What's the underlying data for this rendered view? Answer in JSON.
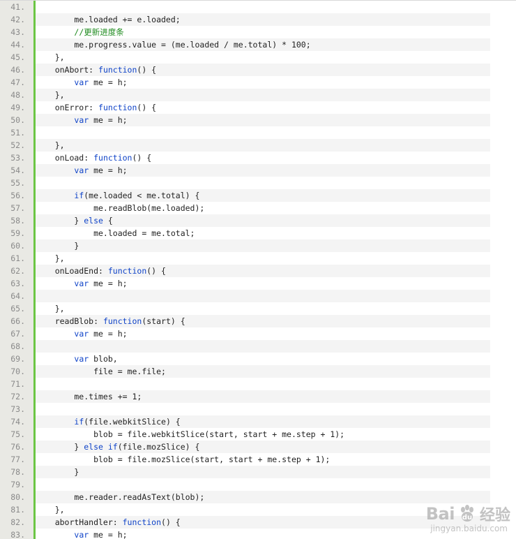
{
  "code_view": {
    "lines": [
      {
        "num": "41.",
        "tokens": [
          {
            "t": "",
            "c": "pl"
          }
        ]
      },
      {
        "num": "42.",
        "tokens": [
          {
            "t": "        me.loaded += e.loaded;",
            "c": "pl"
          }
        ]
      },
      {
        "num": "43.",
        "tokens": [
          {
            "t": "        ",
            "c": "pl"
          },
          {
            "t": "//更新进度条",
            "c": "cm"
          }
        ]
      },
      {
        "num": "44.",
        "tokens": [
          {
            "t": "        me.progress.value = (me.loaded / me.total) * 100;",
            "c": "pl"
          }
        ]
      },
      {
        "num": "45.",
        "tokens": [
          {
            "t": "    },",
            "c": "pl"
          }
        ]
      },
      {
        "num": "46.",
        "tokens": [
          {
            "t": "    onAbort: ",
            "c": "pl"
          },
          {
            "t": "function",
            "c": "kw"
          },
          {
            "t": "() {",
            "c": "pl"
          }
        ]
      },
      {
        "num": "47.",
        "tokens": [
          {
            "t": "        ",
            "c": "pl"
          },
          {
            "t": "var",
            "c": "kw"
          },
          {
            "t": " me = h;",
            "c": "pl"
          }
        ]
      },
      {
        "num": "48.",
        "tokens": [
          {
            "t": "    },",
            "c": "pl"
          }
        ]
      },
      {
        "num": "49.",
        "tokens": [
          {
            "t": "    onError: ",
            "c": "pl"
          },
          {
            "t": "function",
            "c": "kw"
          },
          {
            "t": "() {",
            "c": "pl"
          }
        ]
      },
      {
        "num": "50.",
        "tokens": [
          {
            "t": "        ",
            "c": "pl"
          },
          {
            "t": "var",
            "c": "kw"
          },
          {
            "t": " me = h;",
            "c": "pl"
          }
        ]
      },
      {
        "num": "51.",
        "tokens": [
          {
            "t": "",
            "c": "pl"
          }
        ]
      },
      {
        "num": "52.",
        "tokens": [
          {
            "t": "    },",
            "c": "pl"
          }
        ]
      },
      {
        "num": "53.",
        "tokens": [
          {
            "t": "    onLoad: ",
            "c": "pl"
          },
          {
            "t": "function",
            "c": "kw"
          },
          {
            "t": "() {",
            "c": "pl"
          }
        ]
      },
      {
        "num": "54.",
        "tokens": [
          {
            "t": "        ",
            "c": "pl"
          },
          {
            "t": "var",
            "c": "kw"
          },
          {
            "t": " me = h;",
            "c": "pl"
          }
        ]
      },
      {
        "num": "55.",
        "tokens": [
          {
            "t": "",
            "c": "pl"
          }
        ]
      },
      {
        "num": "56.",
        "tokens": [
          {
            "t": "        ",
            "c": "pl"
          },
          {
            "t": "if",
            "c": "kw"
          },
          {
            "t": "(me.loaded < me.total) {",
            "c": "pl"
          }
        ]
      },
      {
        "num": "57.",
        "tokens": [
          {
            "t": "            me.readBlob(me.loaded);",
            "c": "pl"
          }
        ]
      },
      {
        "num": "58.",
        "tokens": [
          {
            "t": "        } ",
            "c": "pl"
          },
          {
            "t": "else",
            "c": "kw"
          },
          {
            "t": " {",
            "c": "pl"
          }
        ]
      },
      {
        "num": "59.",
        "tokens": [
          {
            "t": "            me.loaded = me.total;",
            "c": "pl"
          }
        ]
      },
      {
        "num": "60.",
        "tokens": [
          {
            "t": "        }",
            "c": "pl"
          }
        ]
      },
      {
        "num": "61.",
        "tokens": [
          {
            "t": "    },",
            "c": "pl"
          }
        ]
      },
      {
        "num": "62.",
        "tokens": [
          {
            "t": "    onLoadEnd: ",
            "c": "pl"
          },
          {
            "t": "function",
            "c": "kw"
          },
          {
            "t": "() {",
            "c": "pl"
          }
        ]
      },
      {
        "num": "63.",
        "tokens": [
          {
            "t": "        ",
            "c": "pl"
          },
          {
            "t": "var",
            "c": "kw"
          },
          {
            "t": " me = h;",
            "c": "pl"
          }
        ]
      },
      {
        "num": "64.",
        "tokens": [
          {
            "t": "",
            "c": "pl"
          }
        ]
      },
      {
        "num": "65.",
        "tokens": [
          {
            "t": "    },",
            "c": "pl"
          }
        ]
      },
      {
        "num": "66.",
        "tokens": [
          {
            "t": "    readBlob: ",
            "c": "pl"
          },
          {
            "t": "function",
            "c": "kw"
          },
          {
            "t": "(start) {",
            "c": "pl"
          }
        ]
      },
      {
        "num": "67.",
        "tokens": [
          {
            "t": "        ",
            "c": "pl"
          },
          {
            "t": "var",
            "c": "kw"
          },
          {
            "t": " me = h;",
            "c": "pl"
          }
        ]
      },
      {
        "num": "68.",
        "tokens": [
          {
            "t": "",
            "c": "pl"
          }
        ]
      },
      {
        "num": "69.",
        "tokens": [
          {
            "t": "        ",
            "c": "pl"
          },
          {
            "t": "var",
            "c": "kw"
          },
          {
            "t": " blob,",
            "c": "pl"
          }
        ]
      },
      {
        "num": "70.",
        "tokens": [
          {
            "t": "            file = me.file;",
            "c": "pl"
          }
        ]
      },
      {
        "num": "71.",
        "tokens": [
          {
            "t": "",
            "c": "pl"
          }
        ]
      },
      {
        "num": "72.",
        "tokens": [
          {
            "t": "        me.times += 1;",
            "c": "pl"
          }
        ]
      },
      {
        "num": "73.",
        "tokens": [
          {
            "t": "",
            "c": "pl"
          }
        ]
      },
      {
        "num": "74.",
        "tokens": [
          {
            "t": "        ",
            "c": "pl"
          },
          {
            "t": "if",
            "c": "kw"
          },
          {
            "t": "(file.webkitSlice) {",
            "c": "pl"
          }
        ]
      },
      {
        "num": "75.",
        "tokens": [
          {
            "t": "            blob = file.webkitSlice(start, start + me.step + 1);",
            "c": "pl"
          }
        ]
      },
      {
        "num": "76.",
        "tokens": [
          {
            "t": "        } ",
            "c": "pl"
          },
          {
            "t": "else if",
            "c": "kw"
          },
          {
            "t": "(file.mozSlice) {",
            "c": "pl"
          }
        ]
      },
      {
        "num": "77.",
        "tokens": [
          {
            "t": "            blob = file.mozSlice(start, start + me.step + 1);",
            "c": "pl"
          }
        ]
      },
      {
        "num": "78.",
        "tokens": [
          {
            "t": "        }",
            "c": "pl"
          }
        ]
      },
      {
        "num": "79.",
        "tokens": [
          {
            "t": "",
            "c": "pl"
          }
        ]
      },
      {
        "num": "80.",
        "tokens": [
          {
            "t": "        me.reader.readAsText(blob);",
            "c": "pl"
          }
        ]
      },
      {
        "num": "81.",
        "tokens": [
          {
            "t": "    },",
            "c": "pl"
          }
        ]
      },
      {
        "num": "82.",
        "tokens": [
          {
            "t": "    abortHandler: ",
            "c": "pl"
          },
          {
            "t": "function",
            "c": "kw"
          },
          {
            "t": "() {",
            "c": "pl"
          }
        ]
      },
      {
        "num": "83.",
        "tokens": [
          {
            "t": "        ",
            "c": "pl"
          },
          {
            "t": "var",
            "c": "kw"
          },
          {
            "t": " me = h;",
            "c": "pl"
          }
        ]
      }
    ]
  },
  "watermark": {
    "brand": "Bai",
    "paw_icon": "baidu-paw-icon",
    "suffix": "经验",
    "domain": "jingyan.baidu.com"
  },
  "colors": {
    "keyword": "#0f43c8",
    "comment": "#1d8a1d",
    "gutter_bg": "#e9e9e4",
    "gutter_accent": "#6cc644",
    "alt_row": "#f4f4f4"
  }
}
